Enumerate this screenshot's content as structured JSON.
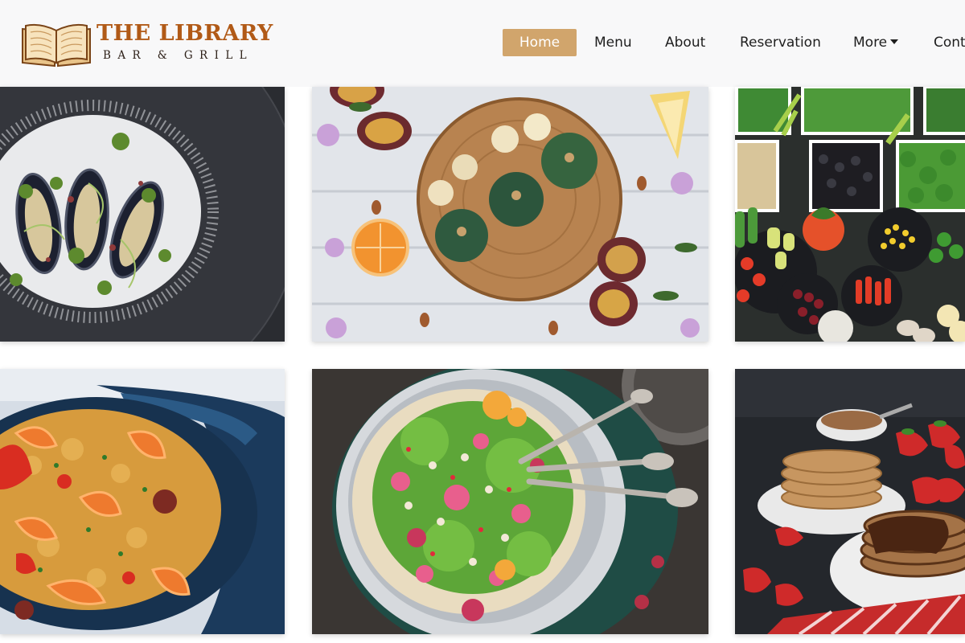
{
  "brand": {
    "title": "THE LIBRARY",
    "subtitle": "BAR & GRILL",
    "accent_color": "#b15a17",
    "book_icon": "open-book-icon"
  },
  "nav": {
    "items": [
      {
        "label": "Home",
        "active": true
      },
      {
        "label": "Menu"
      },
      {
        "label": "About"
      },
      {
        "label": "Reservation"
      },
      {
        "label": "More",
        "dropdown": true
      },
      {
        "label": "Cont"
      }
    ],
    "active_color": "#d1a56c"
  },
  "gallery": [
    {
      "photo": "mussels-on-salt"
    },
    {
      "photo": "desserts-on-wood-board"
    },
    {
      "photo": "salad-bar-vegetables"
    },
    {
      "photo": "paella-in-blue-pot"
    },
    {
      "photo": "hummus-bowl-with-flowers"
    },
    {
      "photo": "pancakes-with-strawberries"
    }
  ]
}
